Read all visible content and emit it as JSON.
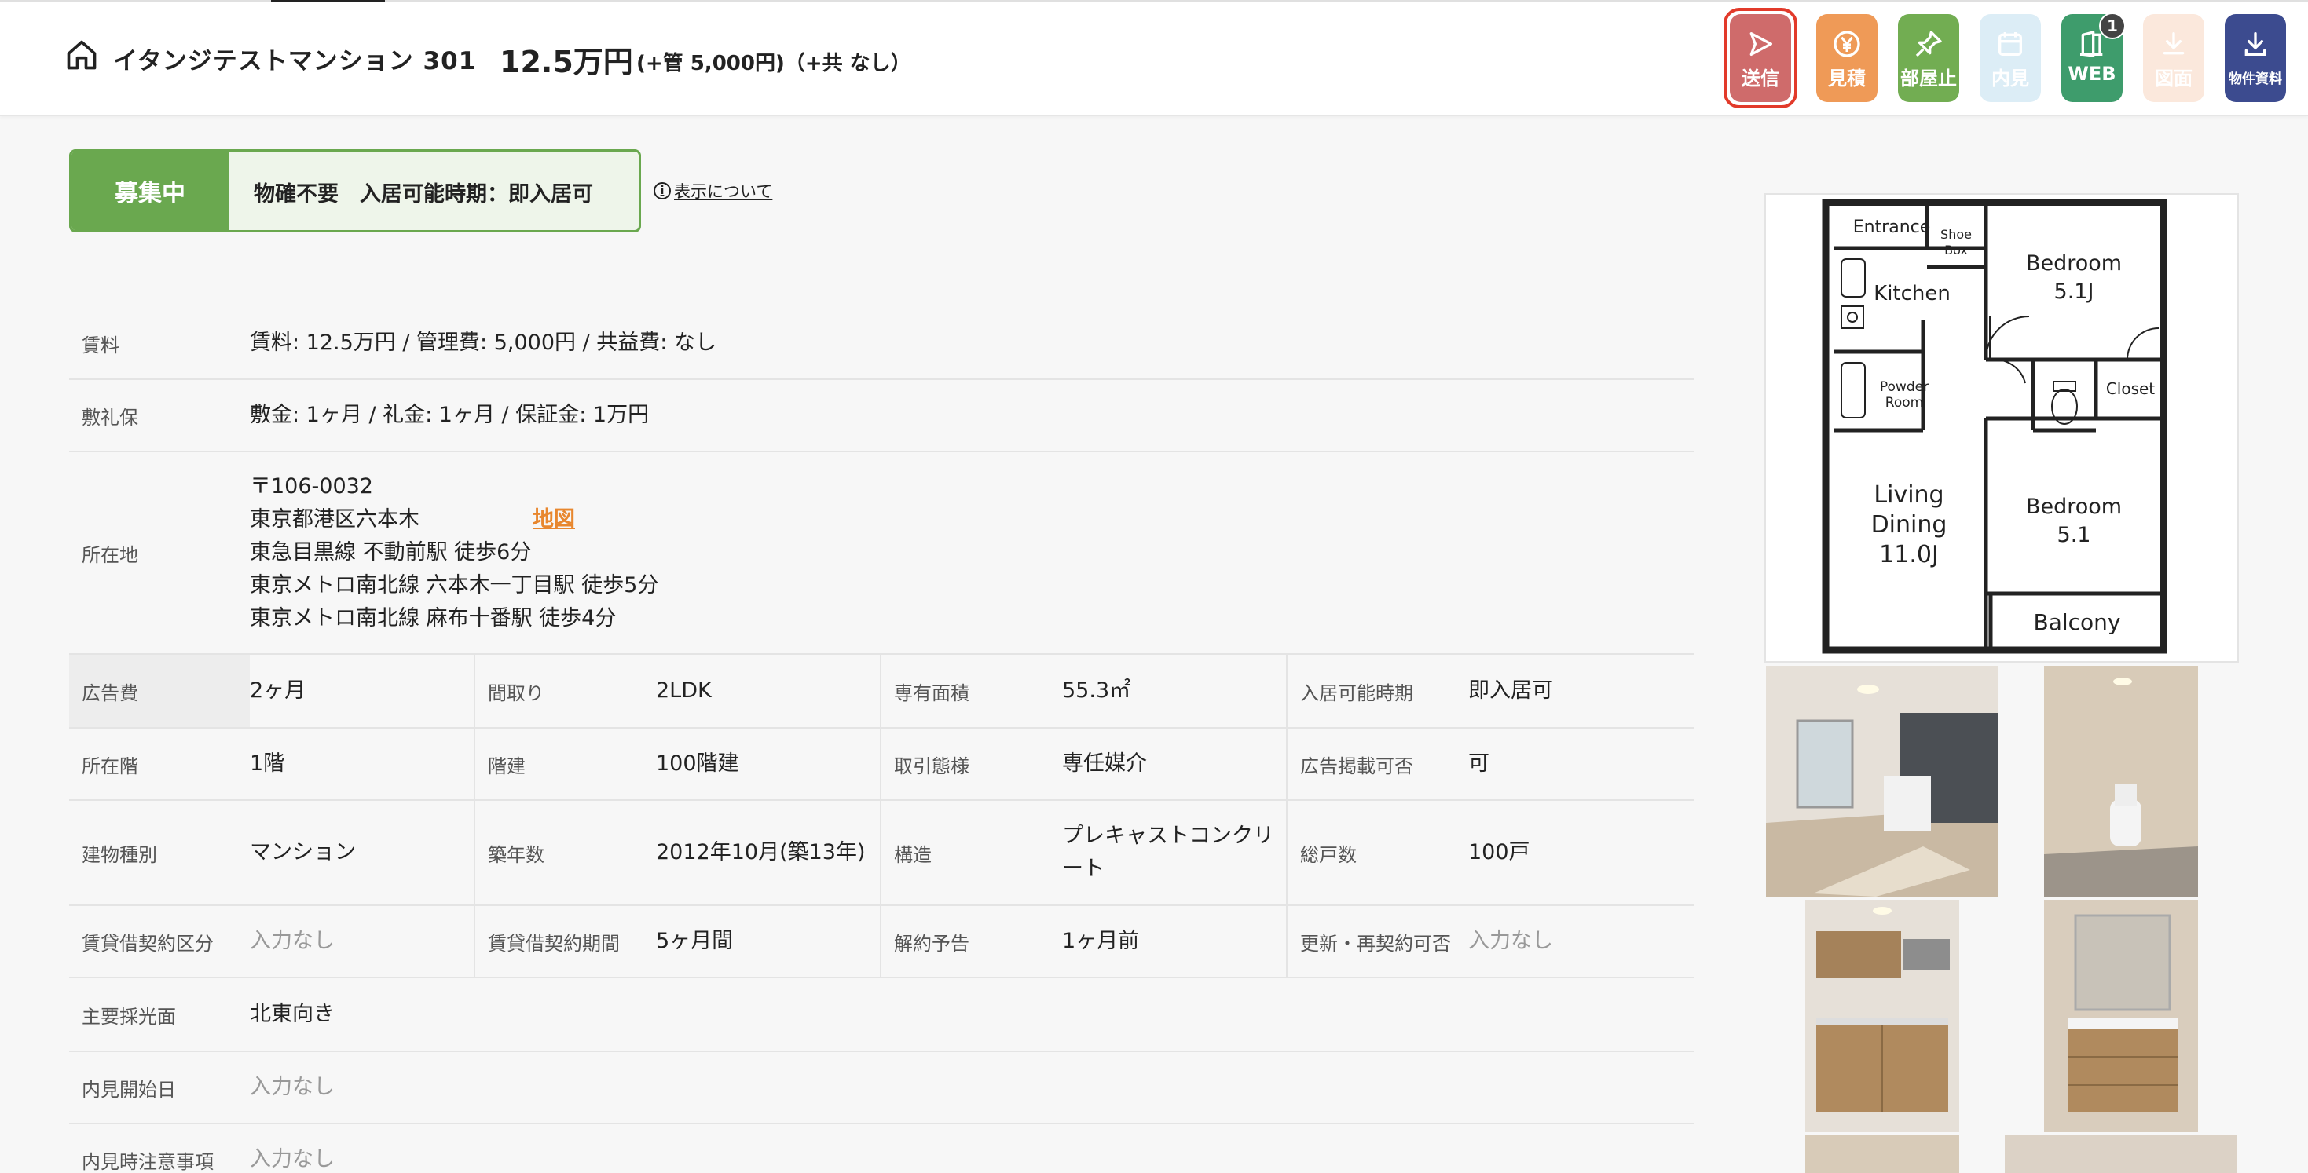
{
  "header": {
    "property_name": "イタンジテストマンション 301",
    "rent": "12.5万円",
    "rent_extra": "(+管 5,000円)（+共 なし）"
  },
  "toolbar": {
    "send_label": "送信",
    "estimate_label": "見積",
    "room_stop_label": "部屋止",
    "viewing_label": "内見",
    "web_label": "WEB",
    "web_badge": "1",
    "floorplan_label": "図面",
    "docs_label": "物件資料"
  },
  "status": {
    "label": "募集中",
    "text": "物確不要　入居可能時期：即入居可",
    "about_link": "表示について",
    "info_glyph": "i"
  },
  "details": {
    "rent_label": "賃料",
    "rent_value": "賃料: 12.5万円 / 管理費: 5,000円 / 共益費: なし",
    "deposit_label": "敷礼保",
    "deposit_value": "敷金: 1ヶ月 / 礼金: 1ヶ月 / 保証金: 1万円",
    "location_label": "所在地",
    "postal": "〒106-0032",
    "address": "東京都港区六本木",
    "map_link": "地図",
    "station1": "東急目黒線 不動前駅 徒歩6分",
    "station2": "東京メトロ南北線 六本木一丁目駅 徒歩5分",
    "station3": "東京メトロ南北線 麻布十番駅 徒歩4分"
  },
  "grid": [
    [
      {
        "label": "広告費",
        "value": "2ヶ月"
      },
      {
        "label": "間取り",
        "value": "2LDK"
      },
      {
        "label": "専有面積",
        "value": "55.3㎡"
      },
      {
        "label": "入居可能時期",
        "value": "即入居可"
      }
    ],
    [
      {
        "label": "所在階",
        "value": "1階"
      },
      {
        "label": "階建",
        "value": "100階建"
      },
      {
        "label": "取引態様",
        "value": "専任媒介"
      },
      {
        "label": "広告掲載可否",
        "value": "可"
      }
    ],
    [
      {
        "label": "建物種別",
        "value": "マンション"
      },
      {
        "label": "築年数",
        "value": "2012年10月(築13年)"
      },
      {
        "label": "構造",
        "value": "プレキャストコンクリート"
      },
      {
        "label": "総戸数",
        "value": "100戸"
      }
    ],
    [
      {
        "label": "賃貸借契約区分",
        "value": "入力なし"
      },
      {
        "label": "賃貸借契約期間",
        "value": "5ヶ月間"
      },
      {
        "label": "解約予告",
        "value": "1ヶ月前"
      },
      {
        "label": "更新・再契約可否",
        "value": "入力なし"
      }
    ]
  ],
  "extra": {
    "lighting_label": "主要採光面",
    "lighting_value": "北東向き",
    "viewing_start_label": "内見開始日",
    "viewing_start_value": "入力なし",
    "viewing_notes_label": "内見時注意事項",
    "viewing_notes_value": "入力なし"
  },
  "floorplan": {
    "entrance": "Entrance",
    "shoe": "Shoe",
    "box": "Box",
    "kitchen": "Kitchen",
    "bedroom_a": "Bedroom",
    "bedroom_a_size": "5.1J",
    "closet": "Closet",
    "powder": "Powder",
    "room": "Room",
    "living": "Living",
    "dining": "Dining",
    "living_size": "11.0J",
    "bedroom_b": "Bedroom",
    "bedroom_b_size": "5.1",
    "balcony": "Balcony"
  },
  "colors": {
    "accent_green": "#6aa84f",
    "send": "#cf6b6b",
    "map_link": "#e8872e"
  }
}
